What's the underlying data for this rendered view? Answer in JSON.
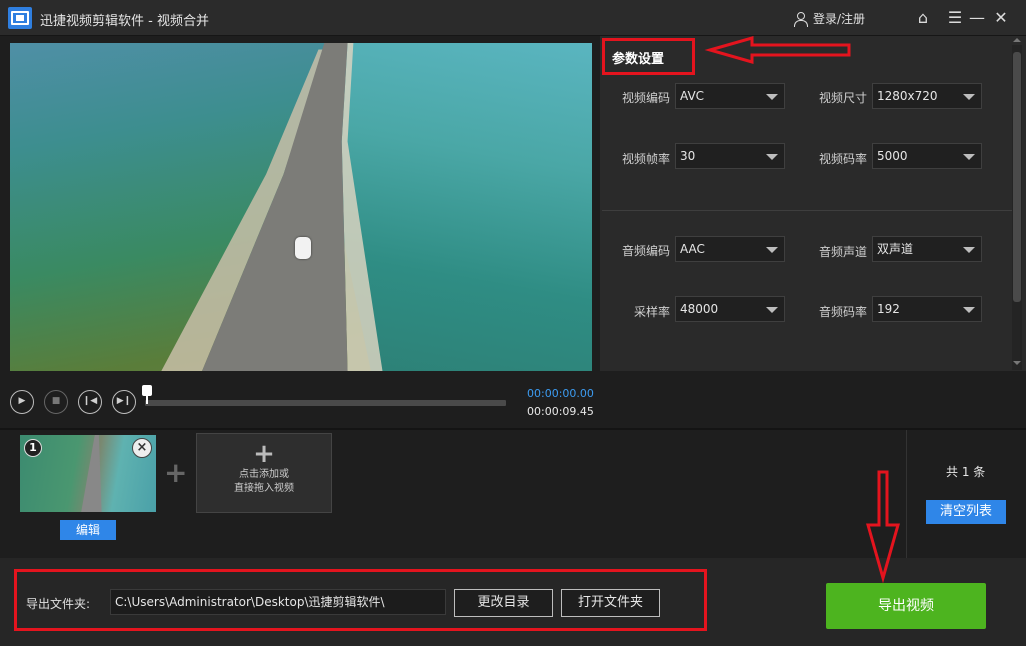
{
  "app": {
    "title": "迅捷视频剪辑软件 - 视频合并",
    "login": "登录/注册"
  },
  "player": {
    "time_current": "00:00:00.00",
    "time_total": "00:00:09.45"
  },
  "settings": {
    "title": "参数设置",
    "video_codec": {
      "label": "视频编码",
      "value": "AVC"
    },
    "video_size": {
      "label": "视频尺寸",
      "value": "1280x720"
    },
    "frame_rate": {
      "label": "视频帧率",
      "value": "30"
    },
    "video_bitrate": {
      "label": "视频码率",
      "value": "5000"
    },
    "audio_codec": {
      "label": "音频编码",
      "value": "AAC"
    },
    "audio_channel": {
      "label": "音频声道",
      "value": "双声道"
    },
    "sample_rate": {
      "label": "采样率",
      "value": "48000"
    },
    "audio_bitrate": {
      "label": "音频码率",
      "value": "192"
    }
  },
  "clips": {
    "items": [
      {
        "number": "1",
        "edit_label": "编辑"
      }
    ],
    "add_line1": "点击添加或",
    "add_line2": "直接拖入视频",
    "count": "共 1 条",
    "clear_label": "清空列表"
  },
  "output": {
    "label": "导出文件夹:",
    "path": "C:\\Users\\Administrator\\Desktop\\迅捷剪辑软件\\",
    "change_dir": "更改目录",
    "open_folder": "打开文件夹",
    "export": "导出视频"
  },
  "colors": {
    "accent_blue": "#2f86e8",
    "export_green": "#4db41f",
    "annotation_red": "#e4141e",
    "time_blue": "#3c9bf0"
  }
}
